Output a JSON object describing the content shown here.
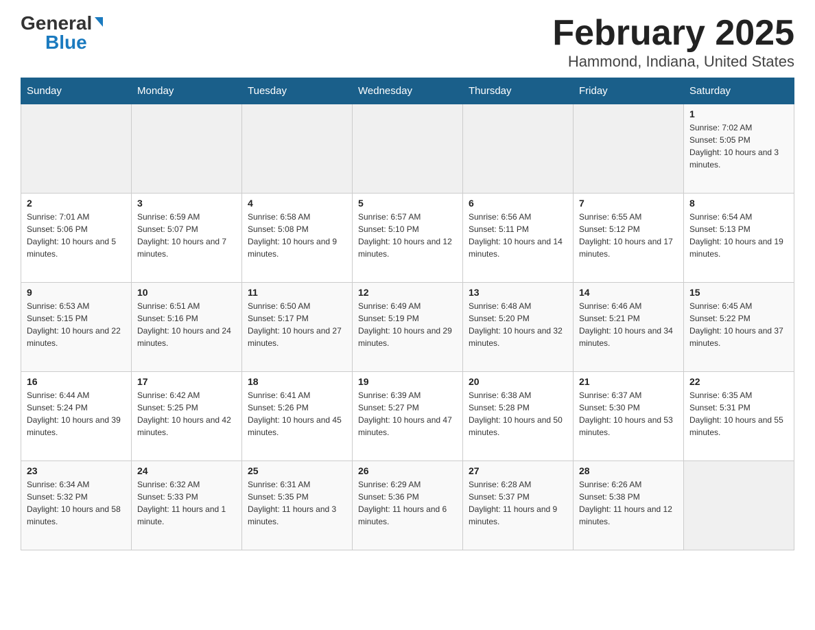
{
  "logo": {
    "general": "General",
    "blue": "Blue"
  },
  "title": "February 2025",
  "subtitle": "Hammond, Indiana, United States",
  "days_of_week": [
    "Sunday",
    "Monday",
    "Tuesday",
    "Wednesday",
    "Thursday",
    "Friday",
    "Saturday"
  ],
  "weeks": [
    [
      {
        "day": "",
        "info": ""
      },
      {
        "day": "",
        "info": ""
      },
      {
        "day": "",
        "info": ""
      },
      {
        "day": "",
        "info": ""
      },
      {
        "day": "",
        "info": ""
      },
      {
        "day": "",
        "info": ""
      },
      {
        "day": "1",
        "info": "Sunrise: 7:02 AM\nSunset: 5:05 PM\nDaylight: 10 hours and 3 minutes."
      }
    ],
    [
      {
        "day": "2",
        "info": "Sunrise: 7:01 AM\nSunset: 5:06 PM\nDaylight: 10 hours and 5 minutes."
      },
      {
        "day": "3",
        "info": "Sunrise: 6:59 AM\nSunset: 5:07 PM\nDaylight: 10 hours and 7 minutes."
      },
      {
        "day": "4",
        "info": "Sunrise: 6:58 AM\nSunset: 5:08 PM\nDaylight: 10 hours and 9 minutes."
      },
      {
        "day": "5",
        "info": "Sunrise: 6:57 AM\nSunset: 5:10 PM\nDaylight: 10 hours and 12 minutes."
      },
      {
        "day": "6",
        "info": "Sunrise: 6:56 AM\nSunset: 5:11 PM\nDaylight: 10 hours and 14 minutes."
      },
      {
        "day": "7",
        "info": "Sunrise: 6:55 AM\nSunset: 5:12 PM\nDaylight: 10 hours and 17 minutes."
      },
      {
        "day": "8",
        "info": "Sunrise: 6:54 AM\nSunset: 5:13 PM\nDaylight: 10 hours and 19 minutes."
      }
    ],
    [
      {
        "day": "9",
        "info": "Sunrise: 6:53 AM\nSunset: 5:15 PM\nDaylight: 10 hours and 22 minutes."
      },
      {
        "day": "10",
        "info": "Sunrise: 6:51 AM\nSunset: 5:16 PM\nDaylight: 10 hours and 24 minutes."
      },
      {
        "day": "11",
        "info": "Sunrise: 6:50 AM\nSunset: 5:17 PM\nDaylight: 10 hours and 27 minutes."
      },
      {
        "day": "12",
        "info": "Sunrise: 6:49 AM\nSunset: 5:19 PM\nDaylight: 10 hours and 29 minutes."
      },
      {
        "day": "13",
        "info": "Sunrise: 6:48 AM\nSunset: 5:20 PM\nDaylight: 10 hours and 32 minutes."
      },
      {
        "day": "14",
        "info": "Sunrise: 6:46 AM\nSunset: 5:21 PM\nDaylight: 10 hours and 34 minutes."
      },
      {
        "day": "15",
        "info": "Sunrise: 6:45 AM\nSunset: 5:22 PM\nDaylight: 10 hours and 37 minutes."
      }
    ],
    [
      {
        "day": "16",
        "info": "Sunrise: 6:44 AM\nSunset: 5:24 PM\nDaylight: 10 hours and 39 minutes."
      },
      {
        "day": "17",
        "info": "Sunrise: 6:42 AM\nSunset: 5:25 PM\nDaylight: 10 hours and 42 minutes."
      },
      {
        "day": "18",
        "info": "Sunrise: 6:41 AM\nSunset: 5:26 PM\nDaylight: 10 hours and 45 minutes."
      },
      {
        "day": "19",
        "info": "Sunrise: 6:39 AM\nSunset: 5:27 PM\nDaylight: 10 hours and 47 minutes."
      },
      {
        "day": "20",
        "info": "Sunrise: 6:38 AM\nSunset: 5:28 PM\nDaylight: 10 hours and 50 minutes."
      },
      {
        "day": "21",
        "info": "Sunrise: 6:37 AM\nSunset: 5:30 PM\nDaylight: 10 hours and 53 minutes."
      },
      {
        "day": "22",
        "info": "Sunrise: 6:35 AM\nSunset: 5:31 PM\nDaylight: 10 hours and 55 minutes."
      }
    ],
    [
      {
        "day": "23",
        "info": "Sunrise: 6:34 AM\nSunset: 5:32 PM\nDaylight: 10 hours and 58 minutes."
      },
      {
        "day": "24",
        "info": "Sunrise: 6:32 AM\nSunset: 5:33 PM\nDaylight: 11 hours and 1 minute."
      },
      {
        "day": "25",
        "info": "Sunrise: 6:31 AM\nSunset: 5:35 PM\nDaylight: 11 hours and 3 minutes."
      },
      {
        "day": "26",
        "info": "Sunrise: 6:29 AM\nSunset: 5:36 PM\nDaylight: 11 hours and 6 minutes."
      },
      {
        "day": "27",
        "info": "Sunrise: 6:28 AM\nSunset: 5:37 PM\nDaylight: 11 hours and 9 minutes."
      },
      {
        "day": "28",
        "info": "Sunrise: 6:26 AM\nSunset: 5:38 PM\nDaylight: 11 hours and 12 minutes."
      },
      {
        "day": "",
        "info": ""
      }
    ]
  ]
}
